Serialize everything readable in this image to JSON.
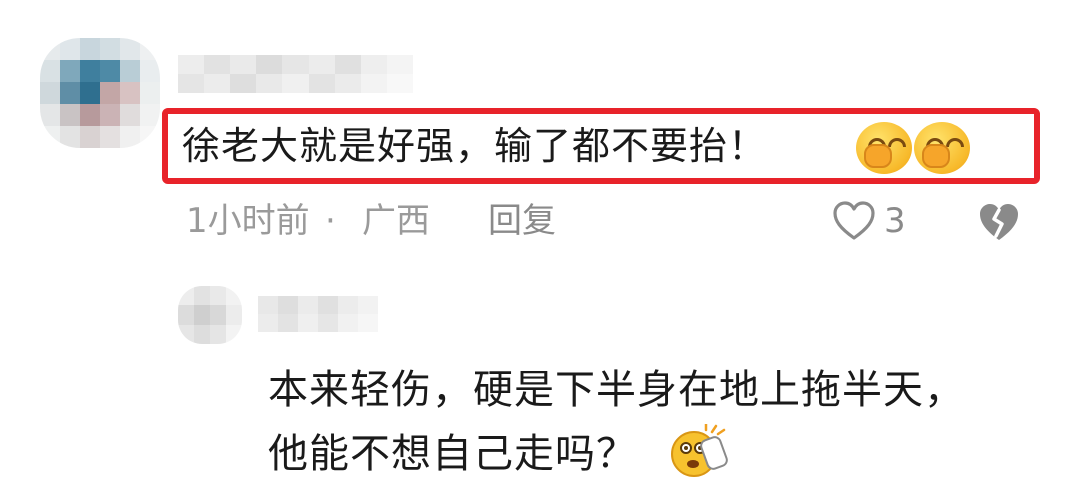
{
  "main_comment": {
    "text": "徐老大就是好强，输了都不要抬！",
    "emojis": [
      "hand-over-mouth-emoji",
      "hand-over-mouth-emoji"
    ],
    "meta": {
      "time": "1小时前",
      "separator": "·",
      "location": "广西",
      "reply_label": "回复"
    },
    "like_count": "3"
  },
  "reply_comment": {
    "lines": [
      "本来轻伤，硬是下半身在地上拖半天，",
      "他能不想自己走吗？"
    ],
    "emoji": "shocked-face-emoji"
  },
  "colors": {
    "highlight": "#e8232a",
    "text": "#1a1a1a",
    "meta": "#9a9a9a"
  }
}
